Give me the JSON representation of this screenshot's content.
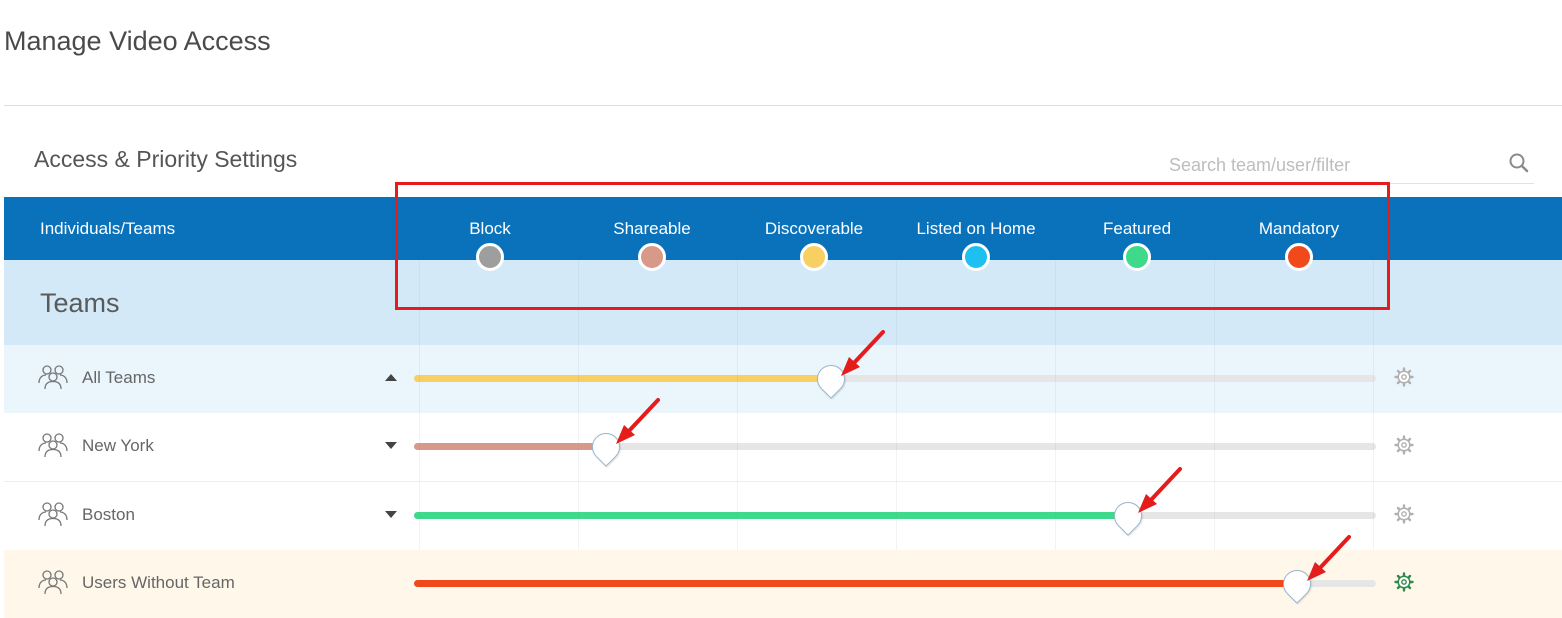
{
  "page": {
    "title": "Manage Video Access"
  },
  "section": {
    "title": "Access & Priority Settings"
  },
  "search": {
    "placeholder": "Search team/user/filter",
    "value": "",
    "icon": "search-icon"
  },
  "table": {
    "column_header": "Individuals/Teams",
    "levels": [
      {
        "label": "Block",
        "color": "#9e9e9e"
      },
      {
        "label": "Shareable",
        "color": "#d89a88"
      },
      {
        "label": "Discoverable",
        "color": "#f7cf62"
      },
      {
        "label": "Listed on Home",
        "color": "#1ec0f2"
      },
      {
        "label": "Featured",
        "color": "#3ed98a"
      },
      {
        "label": "Mandatory",
        "color": "#f04a1c"
      }
    ],
    "group_heading": "Teams",
    "rows": [
      {
        "label": "All Teams",
        "icon": "team-icon",
        "caret": "up",
        "slider_fraction": 0.433,
        "color": "#f7cf62",
        "row_bg": "#eaf5fc",
        "gear_color": "#b0b0b0"
      },
      {
        "label": "New York",
        "icon": "team-icon",
        "caret": "down",
        "slider_fraction": 0.2,
        "color": "#d89a88",
        "row_bg": "#ffffff",
        "gear_color": "#b0b0b0"
      },
      {
        "label": "Boston",
        "icon": "team-icon",
        "caret": "down",
        "slider_fraction": 0.742,
        "color": "#3ed98a",
        "row_bg": "#ffffff",
        "gear_color": "#b0b0b0"
      },
      {
        "label": "Users Without Team",
        "icon": "team-icon",
        "caret": "none",
        "slider_fraction": 0.918,
        "color": "#f04a1c",
        "row_bg": "#fff8ea",
        "gear_color": "#2f8a4a"
      }
    ]
  },
  "annotations": {
    "highlight_color": "#e51c1c",
    "arrow_color": "#e51c1c"
  }
}
